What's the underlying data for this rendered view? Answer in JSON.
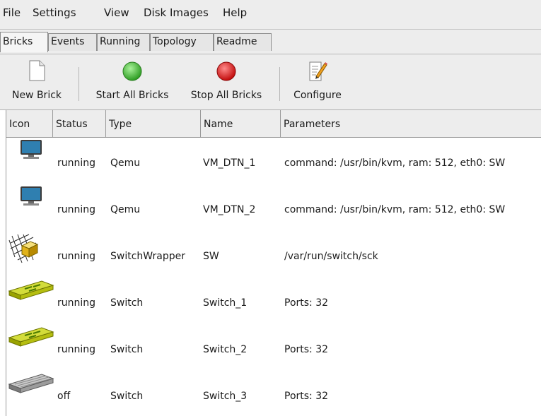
{
  "menu": [
    "File",
    "Settings",
    "View",
    "Disk Images",
    "Help"
  ],
  "tabs": [
    "Bricks",
    "Events",
    "Running",
    "Topology",
    "Readme"
  ],
  "toolbar": {
    "new_brick": "New Brick",
    "start_all": "Start All Bricks",
    "stop_all": "Stop All Bricks",
    "configure": "Configure"
  },
  "columns": [
    "Icon",
    "Status",
    "Type",
    "Name",
    "Parameters"
  ],
  "rows": [
    {
      "icon": "monitor-icon",
      "status": "running",
      "type": "Qemu",
      "name": "VM_DTN_1",
      "params": "command: /usr/bin/kvm, ram: 512, eth0: SW"
    },
    {
      "icon": "monitor-icon",
      "status": "running",
      "type": "Qemu",
      "name": "VM_DTN_2",
      "params": "command: /usr/bin/kvm, ram: 512, eth0: SW"
    },
    {
      "icon": "switch-wrapper-icon",
      "status": "running",
      "type": "SwitchWrapper",
      "name": "SW",
      "params": "/var/run/switch/sck"
    },
    {
      "icon": "switch-active-icon",
      "status": "running",
      "type": "Switch",
      "name": "Switch_1",
      "params": "Ports: 32"
    },
    {
      "icon": "switch-active-icon",
      "status": "running",
      "type": "Switch",
      "name": "Switch_2",
      "params": "Ports: 32"
    },
    {
      "icon": "switch-off-icon",
      "status": "off",
      "type": "Switch",
      "name": "Switch_3",
      "params": "Ports: 32"
    }
  ],
  "colors": {
    "start": "#37b52a",
    "stop": "#d11313",
    "switch_active": "#b7c21a",
    "switch_off": "#8c8c8c"
  }
}
